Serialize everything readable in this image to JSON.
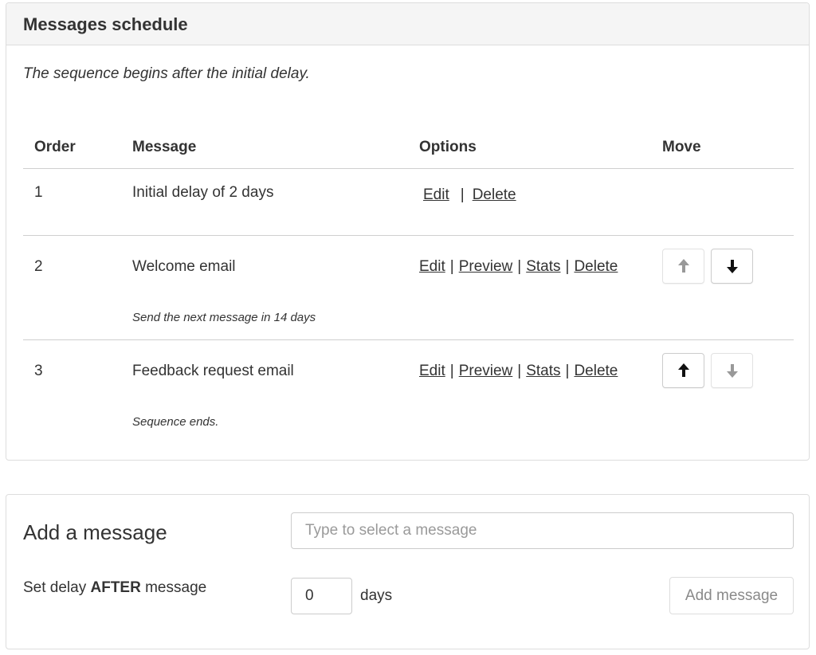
{
  "schedule": {
    "heading": "Messages schedule",
    "subtitle": "The sequence begins after the initial delay.",
    "columns": {
      "order": "Order",
      "message": "Message",
      "options": "Options",
      "move": "Move"
    },
    "rows": [
      {
        "order": "1",
        "message": "Initial delay of 2 days",
        "options": {
          "edit": "Edit",
          "delete": "Delete"
        }
      },
      {
        "order": "2",
        "message": "Welcome email",
        "note": "Send the next message in 14 days",
        "options": {
          "edit": "Edit",
          "preview": "Preview",
          "stats": "Stats",
          "delete": "Delete"
        },
        "move": {
          "up_icon": "arrow-up-icon",
          "up_enabled": false,
          "down_icon": "arrow-down-icon",
          "down_enabled": true
        }
      },
      {
        "order": "3",
        "message": "Feedback request email",
        "note": "Sequence ends.",
        "options": {
          "edit": "Edit",
          "preview": "Preview",
          "stats": "Stats",
          "delete": "Delete"
        },
        "move": {
          "up_icon": "arrow-up-icon",
          "up_enabled": true,
          "down_icon": "arrow-down-icon",
          "down_enabled": false
        }
      }
    ],
    "separator": "|"
  },
  "add": {
    "title": "Add a message",
    "select_placeholder": "Type to select a message",
    "delay_label_prefix": "Set delay ",
    "delay_label_bold": "AFTER",
    "delay_label_suffix": " message",
    "delay_value": "0",
    "delay_unit": "days",
    "button_label": "Add message"
  },
  "colors": {
    "heading_bg": "#f5f5f5",
    "border": "#dddddd",
    "text": "#333333",
    "icon_active": "#111111",
    "icon_disabled": "#999999"
  }
}
